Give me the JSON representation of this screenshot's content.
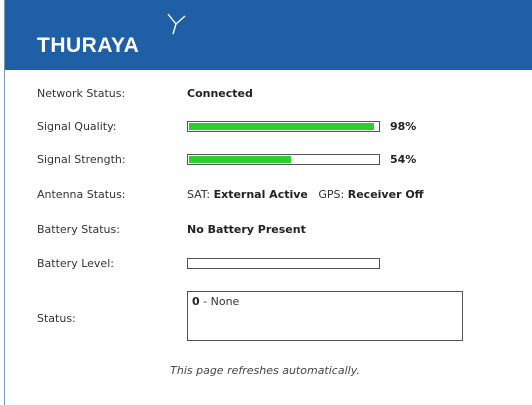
{
  "brand": {
    "name": "THURAYA"
  },
  "network_status": {
    "label": "Network Status:",
    "value": "Connected"
  },
  "signal_quality": {
    "label": "Signal Quality:",
    "percent_text": "98%",
    "level": 0.98
  },
  "signal_strength": {
    "label": "Signal Strength:",
    "percent_text": "54%",
    "level": 0.54
  },
  "antenna_status": {
    "label": "Antenna Status:",
    "sat_label": "SAT:",
    "sat_value": "External Active",
    "gps_label": "GPS:",
    "gps_value": "Receiver Off"
  },
  "battery_status": {
    "label": "Battery Status:",
    "value": "No Battery Present"
  },
  "battery_level": {
    "label": "Battery Level:",
    "level": 0
  },
  "status": {
    "label": "Status:",
    "code": "0",
    "text": " - None"
  },
  "footer": {
    "text": "This page refreshes automatically."
  },
  "colors": {
    "header": "#1f5fa6",
    "bar_fill": "#2ccf2c"
  }
}
